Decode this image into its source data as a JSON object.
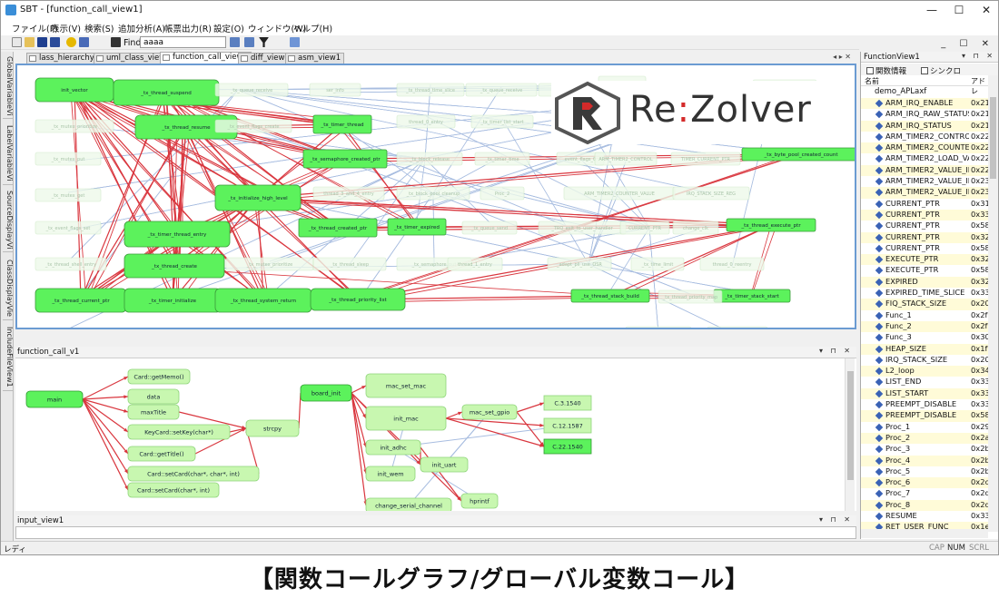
{
  "window": {
    "title": "SBT - [function_call_view1]",
    "min": "—",
    "max": "☐",
    "close": "✕"
  },
  "menu": [
    "ファイル(F)",
    "表示(V)",
    "検索(S)",
    "追加分析(A)",
    "帳票出力(R)",
    "設定(O)",
    "ウィンドウ(W)",
    "ヘルプ(H)"
  ],
  "mdi_controls": "_ ☐ ✕",
  "toolbar": {
    "find_label": "Find",
    "find_value": "aaaa"
  },
  "side_tabs": [
    "GlobalVariableVi",
    "LabelVariableVi",
    "SourceDisplayVi",
    "ClassDisplayVie",
    "IncludeFileView1"
  ],
  "doc_tabs": [
    "lass_hierarchy_1",
    "uml_class_view",
    "function_call_view1",
    "diff_view1",
    "asm_view1"
  ],
  "doc_tab_active": 2,
  "tab_nav": "◂ ▸ ✕",
  "logo_left": "Re",
  "logo_colon": ":",
  "logo_right": "Zolver",
  "graph1": {
    "nodes": [
      {
        "label": "init_vector",
        "hl": true,
        "big": true
      },
      {
        "label": "_tx_thread_suspend",
        "hl": true,
        "big": true
      },
      {
        "label": "_tx_thread_resume",
        "hl": true,
        "big": true
      },
      {
        "label": "_tx_timer_thread",
        "hl": true,
        "big": false
      },
      {
        "label": "_tx_semaphore_created_ptr",
        "hl": true,
        "big": false
      },
      {
        "label": "_tx_initialize_high_level",
        "hl": true,
        "big": true
      },
      {
        "label": "_tx_byte_pool_created_count",
        "hl": true,
        "big": false
      },
      {
        "label": "_tx_thread_created_ptr",
        "hl": true,
        "big": false
      },
      {
        "label": "_tx_timer_expired",
        "hl": true,
        "big": false
      },
      {
        "label": "_tx_timer_thread_entry",
        "hl": true,
        "big": true
      },
      {
        "label": "_tx_thread_execute_ptr",
        "hl": true,
        "big": false
      },
      {
        "label": "_tx_thread_create",
        "hl": true,
        "big": true
      },
      {
        "label": "_tx_thread_current_ptr",
        "hl": true,
        "big": true
      },
      {
        "label": "_tx_timer_initialize",
        "hl": true,
        "big": true
      },
      {
        "label": "_tx_thread_system_return",
        "hl": true,
        "big": true
      },
      {
        "label": "_tx_thread_priority_list",
        "hl": true,
        "big": true
      },
      {
        "label": "_tx_thread_stack_build",
        "hl": true,
        "big": false
      },
      {
        "label": "_tx_timer_stack_start",
        "hl": true,
        "big": false
      },
      {
        "label": "_tx_queue_receive",
        "hl": false,
        "big": false
      },
      {
        "label": "ser_info",
        "hl": false,
        "big": false
      },
      {
        "label": "_tx_thread_time_slice",
        "hl": false,
        "big": false
      },
      {
        "label": "_tx_queue_receive",
        "hl": false,
        "big": false
      },
      {
        "label": "semaphore_0",
        "hl": false,
        "big": false
      },
      {
        "label": "UNUSED_MEMORY",
        "hl": false,
        "big": false
      },
      {
        "label": "C.12.1587",
        "hl": false,
        "big": false
      },
      {
        "label": "C.22.1540",
        "hl": false,
        "big": false
      },
      {
        "label": "_tx_mutex_prioritize",
        "hl": false,
        "big": false
      },
      {
        "label": "_tx_event_flags_create",
        "hl": false,
        "big": false
      },
      {
        "label": "thread_0_entry",
        "hl": false,
        "big": false
      },
      {
        "label": "_tx_timer_list_start",
        "hl": false,
        "big": false
      },
      {
        "label": "TIMER2_0_counter",
        "hl": false,
        "big": false
      },
      {
        "label": "_tx_mutex_put",
        "hl": false,
        "big": false
      },
      {
        "label": "_tx_block_release",
        "hl": false,
        "big": false
      },
      {
        "label": "_tx_timer_time",
        "hl": false,
        "big": false
      },
      {
        "label": "event_flags_0",
        "hl": false,
        "big": false
      },
      {
        "label": "ARM_TIMER2_CONTROL",
        "hl": false,
        "big": false
      },
      {
        "label": "TIMER_CURRENT_PTR",
        "hl": false,
        "big": false
      },
      {
        "label": "_tx_mutex_get",
        "hl": false,
        "big": false
      },
      {
        "label": "thread_3_and_4_entry",
        "hl": false,
        "big": false
      },
      {
        "label": "_tx_block_pool_cleanup",
        "hl": false,
        "big": false
      },
      {
        "label": "Proc_2",
        "hl": false,
        "big": false
      },
      {
        "label": "ARM_TIMER2_COUNTER_VALUE",
        "hl": false,
        "big": false
      },
      {
        "label": "IRQ_STACK_SIZE_REG",
        "hl": false,
        "big": false
      },
      {
        "label": "_tx_event_flags_set",
        "hl": false,
        "big": false
      },
      {
        "label": "_tx_queue_send",
        "hl": false,
        "big": false
      },
      {
        "label": "_TRQ_exit_to_user_handler",
        "hl": false,
        "big": false
      },
      {
        "label": "CURRENT_PTR",
        "hl": false,
        "big": false
      },
      {
        "label": "change_clk",
        "hl": false,
        "big": false
      },
      {
        "label": "_tx_thread_shell_entry",
        "hl": false,
        "big": false
      },
      {
        "label": "_tx_mutex_prioritize",
        "hl": false,
        "big": false
      },
      {
        "label": "_tx_thread_sleep",
        "hl": false,
        "big": false
      },
      {
        "label": "_tx_semaphore_put",
        "hl": false,
        "big": false
      },
      {
        "label": "thread_1_entry",
        "hl": false,
        "big": false
      },
      {
        "label": "_adapt_pll_use_OSR",
        "hl": false,
        "big": false
      },
      {
        "label": "_tx_time_limit",
        "hl": false,
        "big": false
      },
      {
        "label": "thread_0_reentry",
        "hl": false,
        "big": false
      },
      {
        "label": "_tx_mutex_create",
        "hl": false,
        "big": false
      },
      {
        "label": "_tx_thread_priority_map",
        "hl": false,
        "big": false
      },
      {
        "label": "ARM_TIMERS_LOAD_VALUE",
        "hl": false,
        "big": false
      },
      {
        "label": "TIMER2_COUNTER_VALUE",
        "hl": false,
        "big": false
      }
    ]
  },
  "panel2_title": "function_call_v1",
  "panel_controls": "▾ ⊓ ✕",
  "graph2": {
    "nodes": [
      {
        "label": "main",
        "kind": "bright"
      },
      {
        "label": "Card::getMemo()",
        "kind": "light"
      },
      {
        "label": "data",
        "kind": "light"
      },
      {
        "label": "maxTitle",
        "kind": "light"
      },
      {
        "label": "KeyCard::setKey(char*)",
        "kind": "light"
      },
      {
        "label": "strcpy",
        "kind": "light"
      },
      {
        "label": "Card::getTitle()",
        "kind": "light"
      },
      {
        "label": "Card::setCard(char*, char*, int)",
        "kind": "light"
      },
      {
        "label": "Card::setCard(char*, int)",
        "kind": "light"
      },
      {
        "label": "board_init",
        "kind": "bright"
      },
      {
        "label": "mac_set_mac",
        "kind": "light"
      },
      {
        "label": "init_mac",
        "kind": "light"
      },
      {
        "label": "mac_set_gpio",
        "kind": "light"
      },
      {
        "label": "init_adhc",
        "kind": "light"
      },
      {
        "label": "init_uart",
        "kind": "light"
      },
      {
        "label": "init_wem",
        "kind": "light"
      },
      {
        "label": "hprintf",
        "kind": "light"
      },
      {
        "label": "change_serial_channel",
        "kind": "light"
      },
      {
        "label": "C.3.1540",
        "kind": "light"
      },
      {
        "label": "C.12.1587",
        "kind": "light"
      },
      {
        "label": "C.22.1540",
        "kind": "bright"
      }
    ]
  },
  "panel3_title": "input_view1",
  "status": {
    "text": "レディ",
    "cap": "CAP",
    "num": "NUM",
    "scrl": "SCRL"
  },
  "right_panel": {
    "title": "FunctionView1",
    "controls": "▾ ⊓ ✕",
    "opt1": "関数情報",
    "opt2": "シンクロ",
    "col_name": "名前",
    "col_addr": "アドレ",
    "root": "demo_APLaxf",
    "items": [
      {
        "name": "ARM_IRQ_ENABLE",
        "addr": "0x21"
      },
      {
        "name": "ARM_IRQ_RAW_STATUS",
        "addr": "0x21"
      },
      {
        "name": "ARM_IRQ_STATUS",
        "addr": "0x21"
      },
      {
        "name": "ARM_TIMER2_CONTROL",
        "addr": "0x22"
      },
      {
        "name": "ARM_TIMER2_COUNTER_...",
        "addr": "0x22"
      },
      {
        "name": "ARM_TIMER2_LOAD_VALUE",
        "addr": "0x22"
      },
      {
        "name": "ARM_TIMER2_VALUE_IPG...",
        "addr": "0x22"
      },
      {
        "name": "ARM_TIMER2_VALUE_IPG...",
        "addr": "0x23"
      },
      {
        "name": "ARM_TIMER2_VALUE_IPG...",
        "addr": "0x23"
      },
      {
        "name": "CURRENT_PTR",
        "addr": "0x31"
      },
      {
        "name": "CURRENT_PTR",
        "addr": "0x33"
      },
      {
        "name": "CURRENT_PTR",
        "addr": "0x58"
      },
      {
        "name": "CURRENT_PTR",
        "addr": "0x32"
      },
      {
        "name": "CURRENT_PTR",
        "addr": "0x58"
      },
      {
        "name": "EXECUTE_PTR",
        "addr": "0x32"
      },
      {
        "name": "EXECUTE_PTR",
        "addr": "0x58"
      },
      {
        "name": "EXPIRED",
        "addr": "0x32"
      },
      {
        "name": "EXPIRED_TIME_SLICE",
        "addr": "0x33"
      },
      {
        "name": "FIQ_STACK_SIZE",
        "addr": "0x20"
      },
      {
        "name": "Func_1",
        "addr": "0x2f"
      },
      {
        "name": "Func_2",
        "addr": "0x2f"
      },
      {
        "name": "Func_3",
        "addr": "0x30"
      },
      {
        "name": "HEAP_SIZE",
        "addr": "0x1f"
      },
      {
        "name": "IRQ_STACK_SIZE",
        "addr": "0x20"
      },
      {
        "name": "L2_loop",
        "addr": "0x34"
      },
      {
        "name": "LIST_END",
        "addr": "0x33"
      },
      {
        "name": "LIST_START",
        "addr": "0x33"
      },
      {
        "name": "PREEMPT_DISABLE",
        "addr": "0x33"
      },
      {
        "name": "PREEMPT_DISABLE",
        "addr": "0x58"
      },
      {
        "name": "Proc_1",
        "addr": "0x29"
      },
      {
        "name": "Proc_2",
        "addr": "0x2a"
      },
      {
        "name": "Proc_3",
        "addr": "0x2b"
      },
      {
        "name": "Proc_4",
        "addr": "0x2b"
      },
      {
        "name": "Proc_5",
        "addr": "0x2b"
      },
      {
        "name": "Proc_6",
        "addr": "0x2c"
      },
      {
        "name": "Proc_7",
        "addr": "0x2d"
      },
      {
        "name": "Proc_8",
        "addr": "0x2d"
      },
      {
        "name": "RESUME",
        "addr": "0x33"
      },
      {
        "name": "RET_USER_FUNC",
        "addr": "0x1e"
      }
    ]
  },
  "caption": "【関数コールグラフ/グローバル変数コール】",
  "colors": {
    "node_bright": "#5cf25c",
    "node_light": "#c8f7b0",
    "edge_red": "#d9363e",
    "edge_blue": "#a8bde0",
    "accent": "#6b9bd2"
  }
}
